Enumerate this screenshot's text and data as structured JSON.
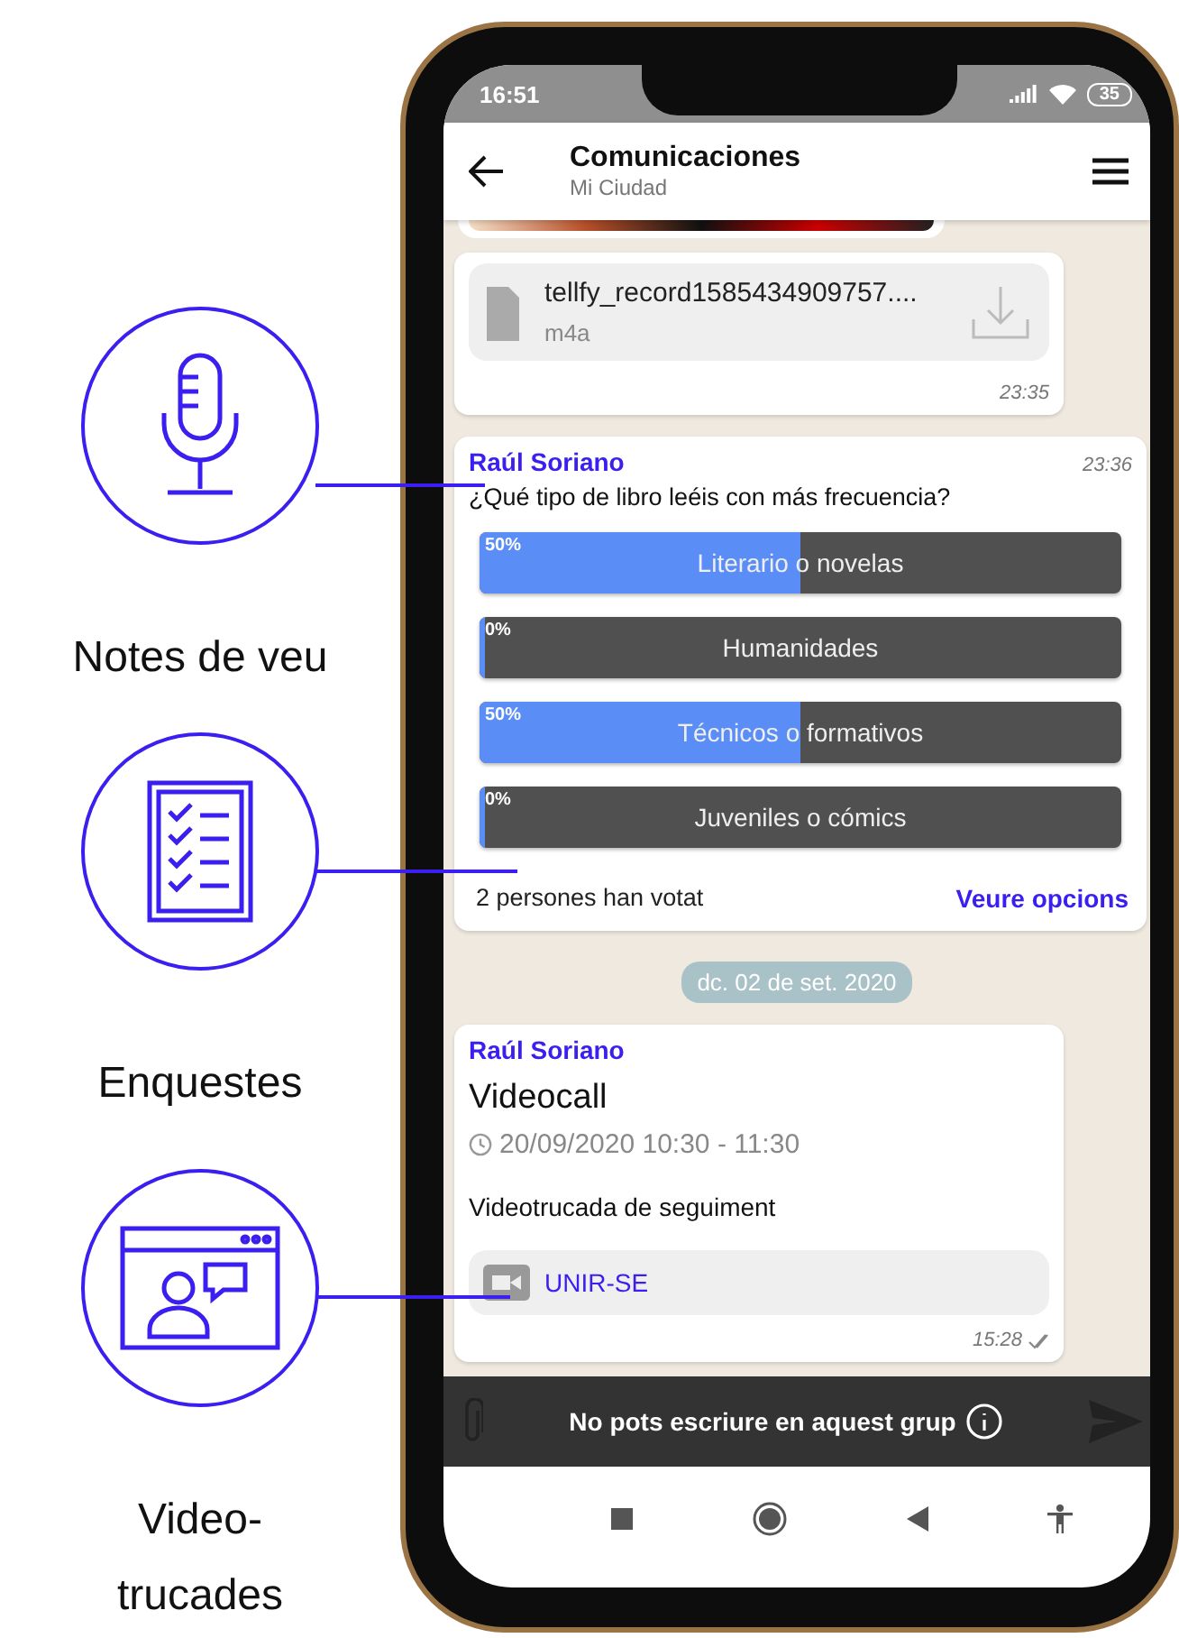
{
  "features": [
    {
      "kind": "voice",
      "label": "Notes de veu"
    },
    {
      "kind": "poll",
      "label": "Enquestes"
    },
    {
      "kind": "video",
      "label": "Video-trucades"
    }
  ],
  "status_bar": {
    "time": "16:51",
    "battery": "35"
  },
  "header": {
    "title": "Comunicaciones",
    "subtitle": "Mi Ciudad"
  },
  "messages": [
    {
      "kind": "media_edge"
    },
    {
      "kind": "file",
      "file_name": "tellfy_record1585434909757....",
      "file_type": "m4a",
      "time": "23:35"
    },
    {
      "kind": "poll",
      "sender": "Raúl Soriano",
      "time": "23:36",
      "question": "¿Qué tipo de libro leéis con más frecuencia?",
      "options": [
        {
          "label": "Literario o novelas",
          "percent": "50%",
          "level": 0.5
        },
        {
          "label": "Humanidades",
          "percent": "0%",
          "level": 0
        },
        {
          "label": "Técnicos o formativos",
          "percent": "50%",
          "level": 0.5
        },
        {
          "label": "Juveniles o cómics",
          "percent": "0%",
          "level": 0
        }
      ],
      "votes": "2 persones han votat",
      "action": "Veure opcions"
    },
    {
      "kind": "date",
      "label": "dc. 02 de set. 2020"
    },
    {
      "kind": "event",
      "sender": "Raúl Soriano",
      "title": "Videocall",
      "schedule": "20/09/2020 10:30 - 11:30",
      "description": "Videotrucada de seguiment",
      "join": "UNIR-SE",
      "time": "15:28"
    }
  ],
  "composer": {
    "notice": "No pots escriure en aquest grup"
  }
}
